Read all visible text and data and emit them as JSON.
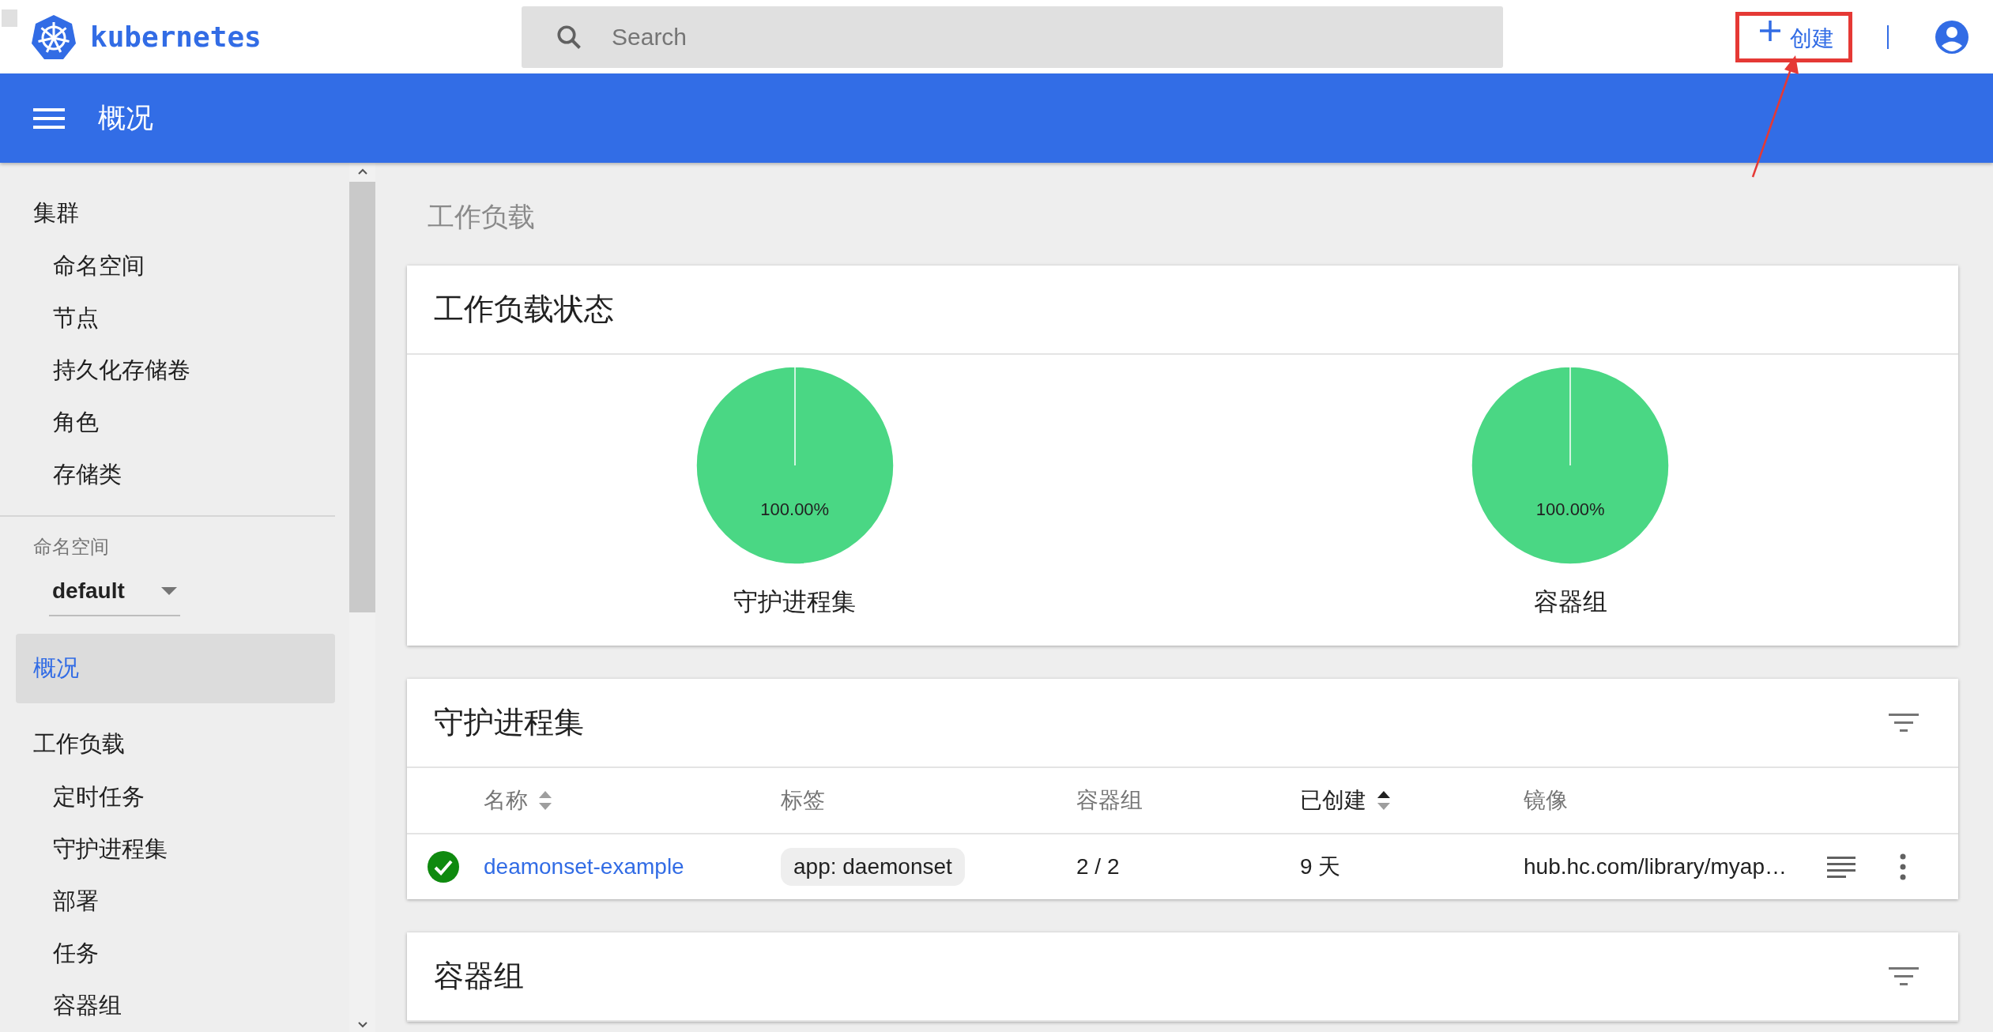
{
  "header": {
    "brand": "kubernetes",
    "search": {
      "placeholder": "Search"
    },
    "create_button": {
      "label": "创建",
      "highlighted": true
    }
  },
  "toolbar": {
    "title": "概况"
  },
  "sidebar": {
    "sections": [
      {
        "kind": "group",
        "label": "集群",
        "selected": false,
        "children": [
          {
            "label": "命名空间",
            "selected": false
          },
          {
            "label": "节点",
            "selected": false
          },
          {
            "label": "持久化存储卷",
            "selected": false
          },
          {
            "label": "角色",
            "selected": false
          },
          {
            "label": "存储类",
            "selected": false
          }
        ]
      },
      {
        "kind": "namespace",
        "label": "命名空间",
        "value": "default"
      },
      {
        "kind": "link",
        "label": "概况",
        "selected": true
      },
      {
        "kind": "group",
        "label": "工作负载",
        "selected": false,
        "children": [
          {
            "label": "定时任务",
            "selected": false
          },
          {
            "label": "守护进程集",
            "selected": false
          },
          {
            "label": "部署",
            "selected": false
          },
          {
            "label": "任务",
            "selected": false
          },
          {
            "label": "容器组",
            "selected": false
          }
        ]
      }
    ]
  },
  "page_title": "工作负载",
  "status_card": {
    "title": "工作负载状态",
    "charts": [
      {
        "caption": "守护进程集",
        "chart_data": {
          "type": "pie",
          "values": [
            100
          ],
          "value_labels": [
            "100.00%"
          ]
        }
      },
      {
        "caption": "容器组",
        "chart_data": {
          "type": "pie",
          "values": [
            100
          ],
          "value_labels": [
            "100.00%"
          ]
        }
      }
    ]
  },
  "daemonsets_card": {
    "title": "守护进程集",
    "columns": [
      {
        "label": "名称",
        "sortable": true,
        "sorted": false
      },
      {
        "label": "标签",
        "sortable": false,
        "sorted": false
      },
      {
        "label": "容器组",
        "sortable": false,
        "sorted": false
      },
      {
        "label": "已创建",
        "sortable": true,
        "sorted": true
      },
      {
        "label": "镜像",
        "sortable": false,
        "sorted": false
      }
    ],
    "rows": [
      {
        "healthy": true,
        "name": "deamonset-example",
        "label": "app: daemonset",
        "pods": "2 / 2",
        "created": "9 天",
        "image": "hub.hc.com/library/myap…"
      }
    ]
  },
  "pods_card": {
    "title": "容器组"
  }
}
